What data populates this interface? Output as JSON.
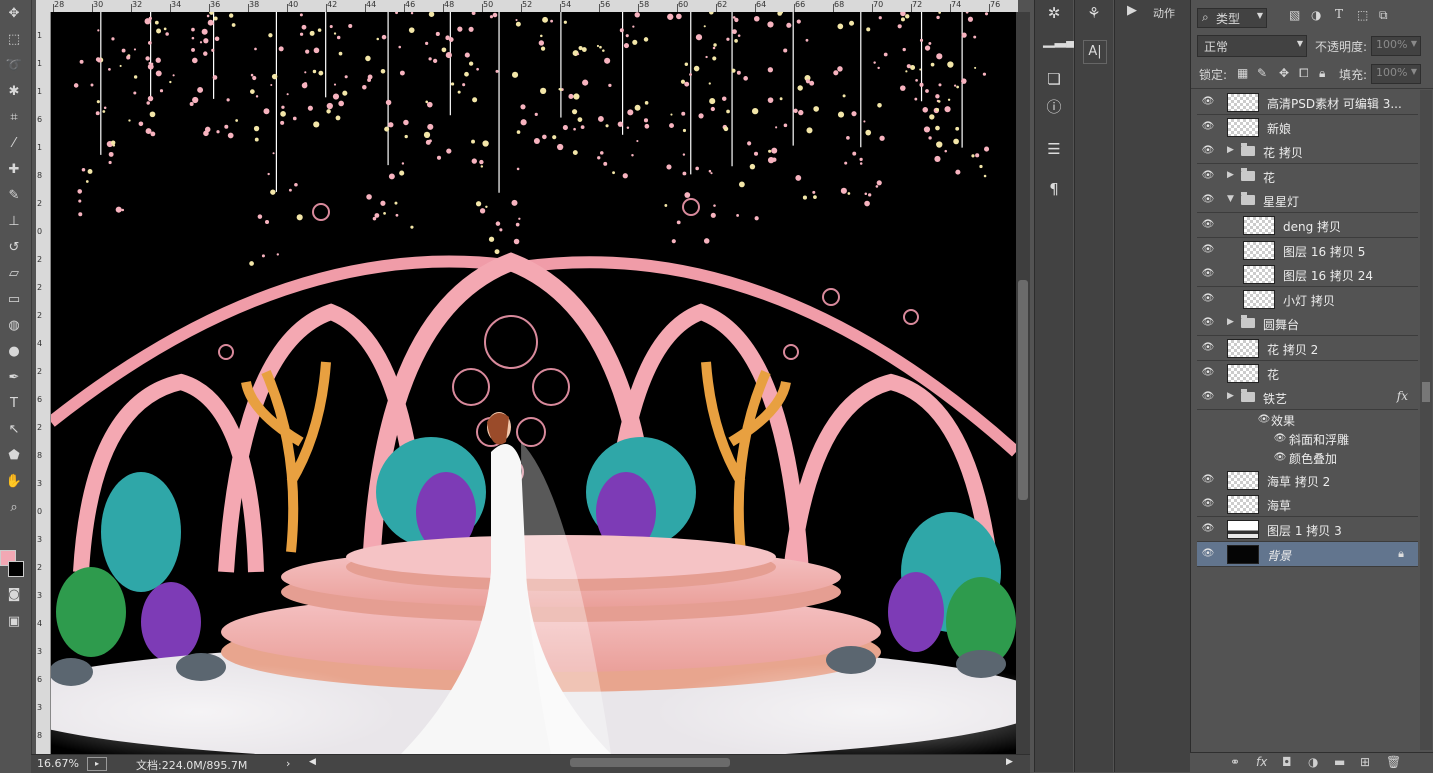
{
  "toolbar": {
    "tools": [
      "move-tool",
      "marquee-tool",
      "lasso-tool",
      "magic-wand-tool",
      "crop-tool",
      "eyedropper-tool",
      "healing-brush-tool",
      "brush-tool",
      "clone-stamp-tool",
      "history-brush-tool",
      "eraser-tool",
      "gradient-tool",
      "blur-tool",
      "dodge-tool",
      "pen-tool",
      "type-tool",
      "path-selection-tool",
      "shape-tool",
      "hand-tool",
      "zoom-tool"
    ],
    "foreground_color": "#f2a8b4",
    "background_color": "#000000"
  },
  "ruler": {
    "h_labels": [
      "28",
      "30",
      "32",
      "34",
      "36",
      "38",
      "40",
      "42",
      "44",
      "46",
      "48",
      "50",
      "52",
      "54",
      "56",
      "58",
      "60",
      "62",
      "64",
      "66",
      "68",
      "70",
      "72",
      "74",
      "76"
    ],
    "v_labels": [
      "1",
      "1",
      "1",
      "6",
      "1",
      "8",
      "2",
      "0",
      "2",
      "2",
      "2",
      "4",
      "2",
      "6",
      "2",
      "8",
      "3",
      "0",
      "3",
      "2",
      "3",
      "4",
      "3",
      "6",
      "3",
      "8"
    ]
  },
  "status": {
    "zoom": "16.67%",
    "doc_info": "文档:224.0M/895.7M"
  },
  "dock": {
    "actions_label": "动作"
  },
  "layers_panel": {
    "filter_kind": "类型",
    "blend_mode": "正常",
    "opacity_label": "不透明度:",
    "opacity_value": "100%",
    "lock_label": "锁定:",
    "fill_label": "填充:",
    "fill_value": "100%",
    "layers": [
      {
        "name": "高清PSD素材 可编辑 3...",
        "kind": "layer",
        "indent": 0
      },
      {
        "name": "新娘",
        "kind": "layer",
        "indent": 0
      },
      {
        "name": "花 拷贝",
        "kind": "group",
        "indent": 0,
        "expanded": false
      },
      {
        "name": "花",
        "kind": "group",
        "indent": 0,
        "expanded": false
      },
      {
        "name": "星星灯",
        "kind": "group",
        "indent": 0,
        "expanded": true
      },
      {
        "name": "deng 拷贝",
        "kind": "layer",
        "indent": 1
      },
      {
        "name": "图层 16 拷贝 5",
        "kind": "layer",
        "indent": 1
      },
      {
        "name": "图层 16 拷贝 24",
        "kind": "layer",
        "indent": 1
      },
      {
        "name": "小灯  拷贝",
        "kind": "layer",
        "indent": 1
      },
      {
        "name": "圆舞台",
        "kind": "group",
        "indent": 0,
        "expanded": false
      },
      {
        "name": "花 拷贝 2",
        "kind": "layer",
        "indent": 0
      },
      {
        "name": "花",
        "kind": "layer",
        "indent": 0
      },
      {
        "name": "铁艺",
        "kind": "group",
        "indent": 0,
        "expanded": false,
        "fx": "fx"
      },
      {
        "name": "效果",
        "kind": "effects",
        "indent": 1
      },
      {
        "name": "斜面和浮雕",
        "kind": "effect",
        "indent": 2
      },
      {
        "name": "颜色叠加",
        "kind": "effect",
        "indent": 2
      },
      {
        "name": "海草 拷贝 2",
        "kind": "layer",
        "indent": 0
      },
      {
        "name": "海草",
        "kind": "layer",
        "indent": 0
      },
      {
        "name": "图层 1 拷贝 3",
        "kind": "layer",
        "indent": 0,
        "thumb": "strip"
      },
      {
        "name": "背景",
        "kind": "background",
        "indent": 0,
        "selected": true,
        "locked": true
      }
    ]
  }
}
